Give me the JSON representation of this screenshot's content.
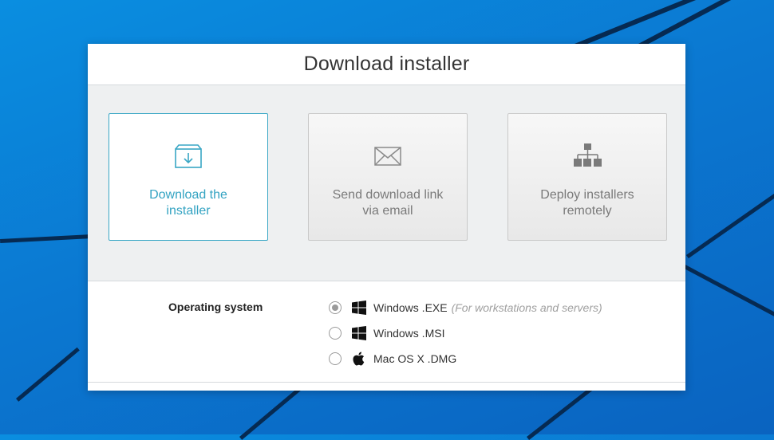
{
  "dialog": {
    "title": "Download installer"
  },
  "options": [
    {
      "label_line1": "Download the",
      "label_line2": "installer",
      "icon": "download-tray-icon",
      "selected": true
    },
    {
      "label_line1": "Send download link",
      "label_line2": "via email",
      "icon": "envelope-icon",
      "selected": false
    },
    {
      "label_line1": "Deploy installers",
      "label_line2": "remotely",
      "icon": "network-tree-icon",
      "selected": false
    }
  ],
  "os_section": {
    "label": "Operating system",
    "choices": [
      {
        "label": "Windows .EXE",
        "note": "(For workstations and servers)",
        "icon": "windows-icon",
        "checked": true
      },
      {
        "label": "Windows .MSI",
        "note": "",
        "icon": "windows-icon",
        "checked": false
      },
      {
        "label": "Mac OS X .DMG",
        "note": "",
        "icon": "apple-icon",
        "checked": false
      }
    ]
  },
  "colors": {
    "accent": "#33a3c2",
    "desktop": "#0b78d1"
  }
}
